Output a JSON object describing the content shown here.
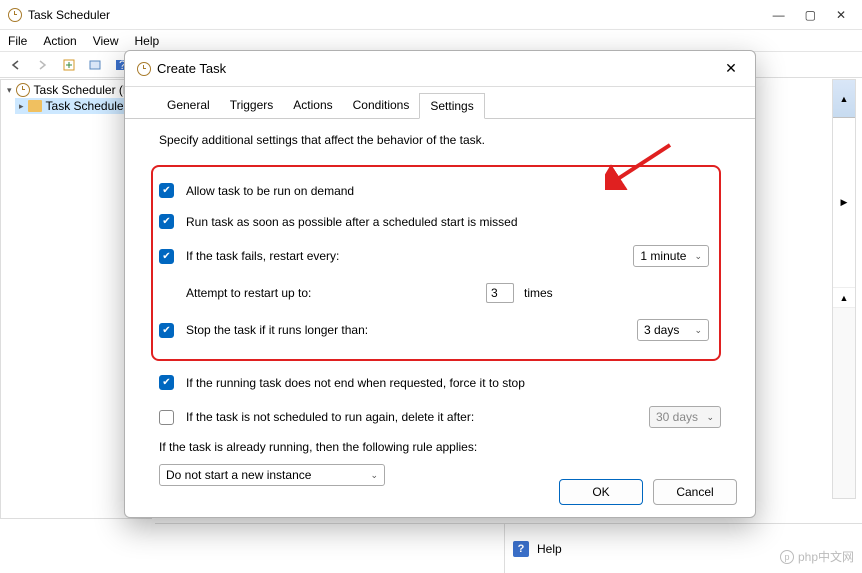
{
  "window": {
    "title": "Task Scheduler",
    "controls": {
      "min": "—",
      "max": "▢",
      "close": "✕"
    }
  },
  "menu": [
    "File",
    "Action",
    "View",
    "Help"
  ],
  "tree": {
    "root": "Task Scheduler (L",
    "child": "Task Schedule"
  },
  "right_collapse": {
    "a": "▲",
    "b": "▶",
    "c": "▲"
  },
  "dialog": {
    "title": "Create Task",
    "close": "✕",
    "tabs": [
      "General",
      "Triggers",
      "Actions",
      "Conditions",
      "Settings"
    ],
    "active_tab": 4,
    "description": "Specify additional settings that affect the behavior of the task.",
    "opt_allow": "Allow task to be run on demand",
    "opt_run_missed": "Run task as soon as possible after a scheduled start is missed",
    "opt_fails": "If the task fails, restart every:",
    "restart_every": "1 minute",
    "attempt_label": "Attempt to restart up to:",
    "attempt_value": "3",
    "attempt_times": "times",
    "opt_stop_long": "Stop the task if it runs longer than:",
    "stop_after": "3 days",
    "opt_force_stop": "If the running task does not end when requested, force it to stop",
    "opt_delete_after": "If the task is not scheduled to run again, delete it after:",
    "delete_after": "30 days",
    "rule_label": "If the task is already running, then the following rule applies:",
    "rule_value": "Do not start a new instance",
    "ok": "OK",
    "cancel": "Cancel"
  },
  "bottom": {
    "help": "Help"
  },
  "watermark": "php中文网"
}
